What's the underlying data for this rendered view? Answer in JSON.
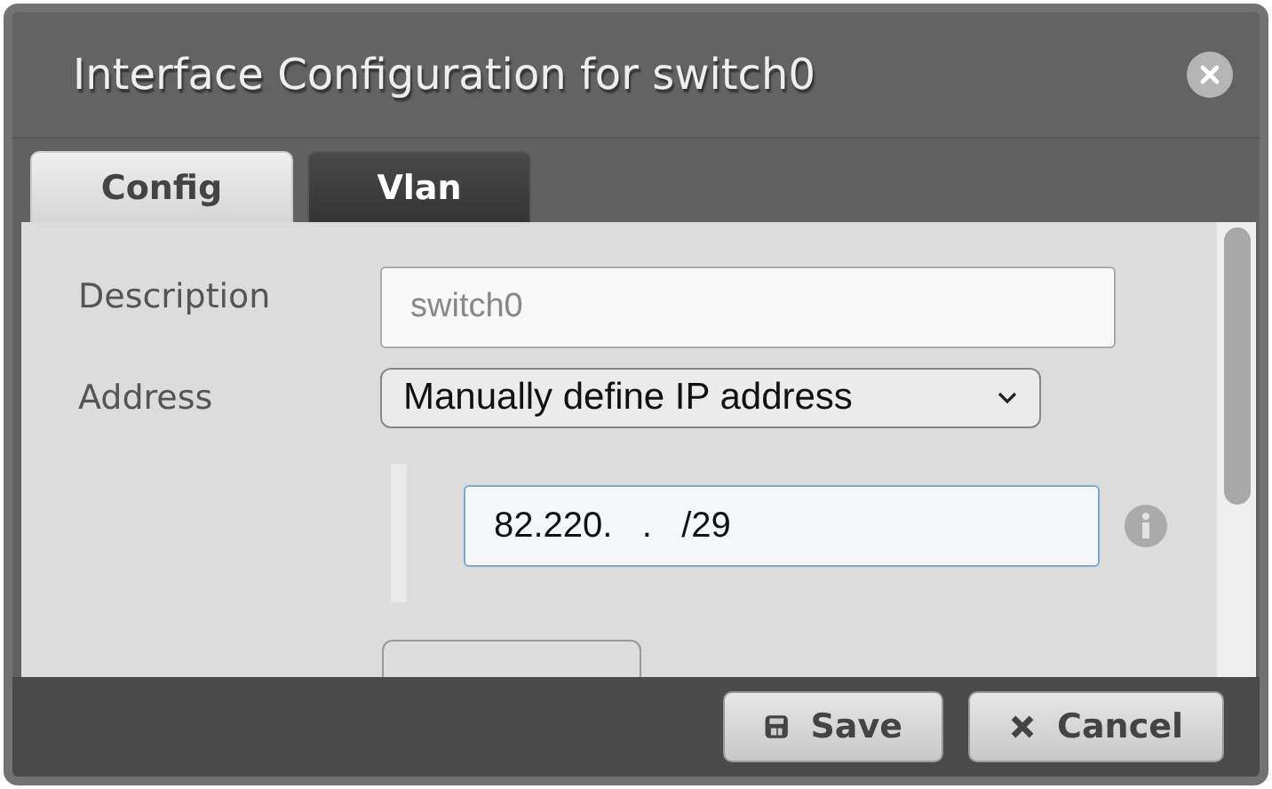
{
  "window": {
    "title": "Interface Configuration for switch0"
  },
  "tabs": [
    {
      "label": "Config",
      "selected": true
    },
    {
      "label": "Vlan",
      "selected": false
    }
  ],
  "form": {
    "description": {
      "label": "Description",
      "placeholder": "switch0"
    },
    "address": {
      "label": "Address",
      "value": "Manually define IP address"
    },
    "ip_addresses": [
      {
        "value": "82.220.   .   /29",
        "focused": true
      }
    ]
  },
  "buttons": [
    {
      "label": "Save",
      "kind": "save"
    },
    {
      "label": "Cancel",
      "kind": "cancel"
    }
  ]
}
